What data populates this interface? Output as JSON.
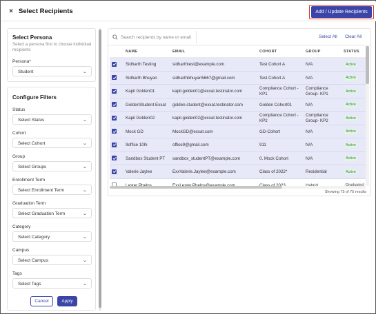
{
  "header": {
    "title": "Select Recipients",
    "close_symbol": "×",
    "primary_action": "Add / Update Recipients",
    "highlight_color": "#d9342b",
    "accent_color": "#3b45a7"
  },
  "persona_card": {
    "title": "Select Persona",
    "description": "Select a persona first to choose individual recipients",
    "field_label": "Persona*",
    "field_value": "Student"
  },
  "filters_card": {
    "title": "Configure Filters",
    "filters": [
      {
        "label": "Status",
        "value": "Select Status"
      },
      {
        "label": "Cohort",
        "value": "Select Cohort"
      },
      {
        "label": "Group",
        "value": "Select Groups"
      },
      {
        "label": "Enrollment Term",
        "value": "Select Enrollment Term"
      },
      {
        "label": "Graduation Term",
        "value": "Select Graduation Term"
      },
      {
        "label": "Category",
        "value": "Select Category"
      },
      {
        "label": "Campus",
        "value": "Select Campus"
      },
      {
        "label": "Tags",
        "value": "Select Tags"
      }
    ],
    "cancel_label": "Cancel",
    "apply_label": "Apply"
  },
  "recipients": {
    "search_placeholder": "Search recipients by name or email",
    "select_all": "Select All",
    "clear_all": "Clear All",
    "columns": [
      "NAME",
      "EMAIL",
      "COHORT",
      "GROUP",
      "STATUS"
    ],
    "rows": [
      {
        "checked": true,
        "name": "Sidharth Testing",
        "email": "sidharthtest@example.com",
        "cohort": "Test Cohort A",
        "group": "N/A",
        "status": "Active"
      },
      {
        "checked": true,
        "name": "Sidharth Bhuyan",
        "email": "sidharthbhuyan5667@gmail.com",
        "cohort": "Test Cohort A",
        "group": "N/A",
        "status": "Active"
      },
      {
        "checked": true,
        "name": "Kapil Golden01",
        "email": "kapil.golden01@exxat.testinator.com",
        "cohort": "Compliance Cohort - KP1",
        "group": "Compliance Group- KP1",
        "status": "Active"
      },
      {
        "checked": true,
        "name": "GoldenStudent Exxat",
        "email": "golden.student@exxat.testinator.com",
        "cohort": "Golden Cohort01",
        "group": "N/A",
        "status": "Active"
      },
      {
        "checked": true,
        "name": "Kapil Golden02",
        "email": "kapil.golden02@exxat.testinator.com",
        "cohort": "Compliance Cohort - KP2",
        "group": "Compliance Group- KP2",
        "status": "Active"
      },
      {
        "checked": true,
        "name": "Mock GD",
        "email": "MockGD@exxat.com",
        "cohort": "GD-Cohort",
        "group": "N/A",
        "status": "Active"
      },
      {
        "checked": true,
        "name": "9office 10hi",
        "email": "office9@gmail.com",
        "cohort": "911",
        "group": "N/A",
        "status": "Active"
      },
      {
        "checked": true,
        "name": "Sandbox Student PT",
        "email": "sandbox_studentPT@example.com",
        "cohort": "0. Mock Cohort",
        "group": "N/A",
        "status": "Active"
      },
      {
        "checked": true,
        "name": "Valerie Jaylee",
        "email": "ExxValerie.Jaylee@example.com",
        "cohort": "Class of 2022*",
        "group": "Residential",
        "status": "Active"
      },
      {
        "checked": false,
        "name": "Lester Phelps",
        "email": "ExxLester.Phelps@example.com",
        "cohort": "Class of 2023",
        "group": "Hybrid",
        "status": "Graduated"
      }
    ],
    "footer": "Showing 75 of 75 results"
  }
}
